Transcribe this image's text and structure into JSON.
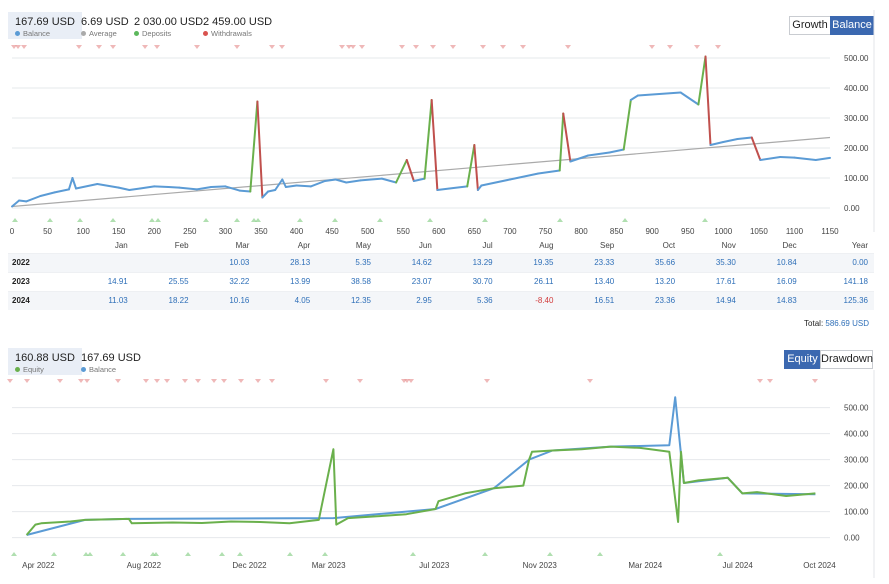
{
  "top_stats": [
    {
      "value": "167.69 USD",
      "label": "Balance",
      "color": "#5b9bd5"
    },
    {
      "value": "6.69 USD",
      "label": "Average",
      "color": "#aaaaaa"
    },
    {
      "value": "2 030.00 USD",
      "label": "Deposits",
      "color": "#5cb85c"
    },
    {
      "value": "2 459.00 USD",
      "label": "Withdrawals",
      "color": "#d9534f"
    }
  ],
  "top_buttons": {
    "growth": "Growth",
    "balance": "Balance"
  },
  "bottom_stats": [
    {
      "value": "160.88 USD",
      "label": "Equity",
      "color": "#6ab04c"
    },
    {
      "value": "167.69 USD",
      "label": "Balance",
      "color": "#5b9bd5"
    }
  ],
  "bottom_buttons": {
    "equity": "Equity",
    "drawdown": "Drawdown"
  },
  "monthly_table": {
    "columns": [
      "",
      "Jan",
      "Feb",
      "Mar",
      "Apr",
      "May",
      "Jun",
      "Jul",
      "Aug",
      "Sep",
      "Oct",
      "Nov",
      "Dec",
      "Year"
    ],
    "rows": [
      {
        "year": "2022",
        "values": [
          "",
          "",
          "10.03",
          "28.13",
          "5.35",
          "14.62",
          "13.29",
          "19.35",
          "23.33",
          "35.66",
          "35.30",
          "10.84",
          "0.00"
        ]
      },
      {
        "year": "2023",
        "values": [
          "14.91",
          "25.55",
          "32.22",
          "13.99",
          "38.58",
          "23.07",
          "30.70",
          "26.11",
          "13.40",
          "13.20",
          "17.61",
          "16.09",
          "141.18"
        ]
      },
      {
        "year": "2024",
        "values": [
          "11.03",
          "18.22",
          "10.16",
          "4.05",
          "12.35",
          "2.95",
          "5.36",
          "-8.40",
          "16.51",
          "23.36",
          "14.94",
          "14.83",
          "125.36"
        ]
      }
    ],
    "total_label": "Total:",
    "total_value": "586.69 USD"
  },
  "chart_data": [
    {
      "type": "line",
      "series": [
        {
          "name": "Balance",
          "color": "#5b9bd5",
          "points": [
            [
              0,
              5
            ],
            [
              10,
              25
            ],
            [
              20,
              22
            ],
            [
              40,
              40
            ],
            [
              60,
              52
            ],
            [
              80,
              62
            ],
            [
              85,
              100
            ],
            [
              90,
              65
            ],
            [
              120,
              80
            ],
            [
              150,
              68
            ],
            [
              165,
              60
            ],
            [
              180,
              65
            ],
            [
              200,
              72
            ],
            [
              220,
              70
            ],
            [
              235,
              68
            ],
            [
              260,
              62
            ],
            [
              280,
              70
            ],
            [
              300,
              72
            ],
            [
              320,
              58
            ],
            [
              335,
              55
            ],
            [
              345,
              355
            ],
            [
              352,
              35
            ],
            [
              360,
              55
            ],
            [
              370,
              60
            ],
            [
              380,
              95
            ],
            [
              385,
              70
            ],
            [
              400,
              75
            ],
            [
              420,
              72
            ],
            [
              440,
              90
            ],
            [
              455,
              95
            ],
            [
              470,
              85
            ],
            [
              490,
              92
            ],
            [
              520,
              98
            ],
            [
              540,
              85
            ],
            [
              555,
              160
            ],
            [
              565,
              90
            ],
            [
              580,
              98
            ],
            [
              590,
              360
            ],
            [
              598,
              60
            ],
            [
              615,
              65
            ],
            [
              640,
              72
            ],
            [
              650,
              210
            ],
            [
              655,
              60
            ],
            [
              660,
              75
            ],
            [
              700,
              95
            ],
            [
              740,
              115
            ],
            [
              770,
              125
            ],
            [
              775,
              315
            ],
            [
              785,
              155
            ],
            [
              810,
              175
            ],
            [
              840,
              185
            ],
            [
              860,
              195
            ],
            [
              870,
              360
            ],
            [
              880,
              375
            ],
            [
              940,
              385
            ],
            [
              965,
              345
            ],
            [
              975,
              505
            ],
            [
              982,
              210
            ],
            [
              1000,
              220
            ],
            [
              1020,
              230
            ],
            [
              1040,
              235
            ],
            [
              1052,
              160
            ],
            [
              1080,
              170
            ],
            [
              1100,
              168
            ],
            [
              1130,
              160
            ],
            [
              1150,
              167
            ]
          ]
        },
        {
          "name": "Average",
          "color": "#aaaaaa",
          "points": [
            [
              0,
              5
            ],
            [
              1150,
              235
            ]
          ]
        }
      ],
      "x_ticks": [
        0,
        50,
        100,
        150,
        200,
        250,
        300,
        350,
        400,
        450,
        500,
        550,
        600,
        650,
        700,
        750,
        800,
        850,
        900,
        950,
        1000,
        1050,
        1100,
        1150
      ],
      "y_ticks": [
        0,
        100,
        200,
        300,
        400,
        500
      ],
      "xlim": [
        0,
        1150
      ],
      "ylim": [
        -40,
        520
      ]
    },
    {
      "type": "line",
      "series": [
        {
          "name": "Equity",
          "color": "#6ab04c",
          "points": [
            [
              0,
              10
            ],
            [
              0.3,
              50
            ],
            [
              0.5,
              55
            ],
            [
              1.5,
              62
            ],
            [
              2,
              68
            ],
            [
              3.5,
              72
            ],
            [
              3.6,
              55
            ],
            [
              5,
              58
            ],
            [
              6,
              56
            ],
            [
              7,
              62
            ],
            [
              8,
              60
            ],
            [
              9,
              55
            ],
            [
              10,
              68
            ],
            [
              10.5,
              340
            ],
            [
              10.6,
              50
            ],
            [
              11,
              75
            ],
            [
              12,
              82
            ],
            [
              13,
              90
            ],
            [
              14,
              110
            ],
            [
              14.1,
              140
            ],
            [
              15,
              170
            ],
            [
              16,
              190
            ],
            [
              17,
              200
            ],
            [
              17.2,
              300
            ],
            [
              17.3,
              330
            ],
            [
              18,
              335
            ],
            [
              19,
              340
            ],
            [
              20,
              350
            ],
            [
              21,
              345
            ],
            [
              22,
              330
            ],
            [
              22.3,
              60
            ],
            [
              22.4,
              330
            ],
            [
              22.5,
              210
            ],
            [
              23,
              220
            ],
            [
              24,
              230
            ],
            [
              24.5,
              170
            ],
            [
              25,
              175
            ],
            [
              26,
              160
            ],
            [
              27,
              170
            ]
          ]
        },
        {
          "name": "Balance",
          "color": "#5b9bd5",
          "points": [
            [
              0,
              10
            ],
            [
              2,
              68
            ],
            [
              3.5,
              72
            ],
            [
              10.5,
              75
            ],
            [
              14,
              110
            ],
            [
              16,
              190
            ],
            [
              17.2,
              300
            ],
            [
              18,
              335
            ],
            [
              20,
              350
            ],
            [
              22,
              355
            ],
            [
              22.2,
              540
            ],
            [
              22.5,
              210
            ],
            [
              24,
              230
            ],
            [
              24.5,
              170
            ],
            [
              27,
              167
            ]
          ]
        }
      ],
      "x_ticks": [
        "Apr 2022",
        "Aug 2022",
        "Dec 2022",
        "Mar 2023",
        "Jul 2023",
        "Nov 2023",
        "Mar 2024",
        "Jul 2024",
        "Oct 2024"
      ],
      "y_ticks": [
        0,
        100,
        200,
        300,
        400,
        500
      ],
      "xlim": [
        -0.5,
        27.5
      ],
      "ylim": [
        -40,
        560
      ]
    }
  ]
}
